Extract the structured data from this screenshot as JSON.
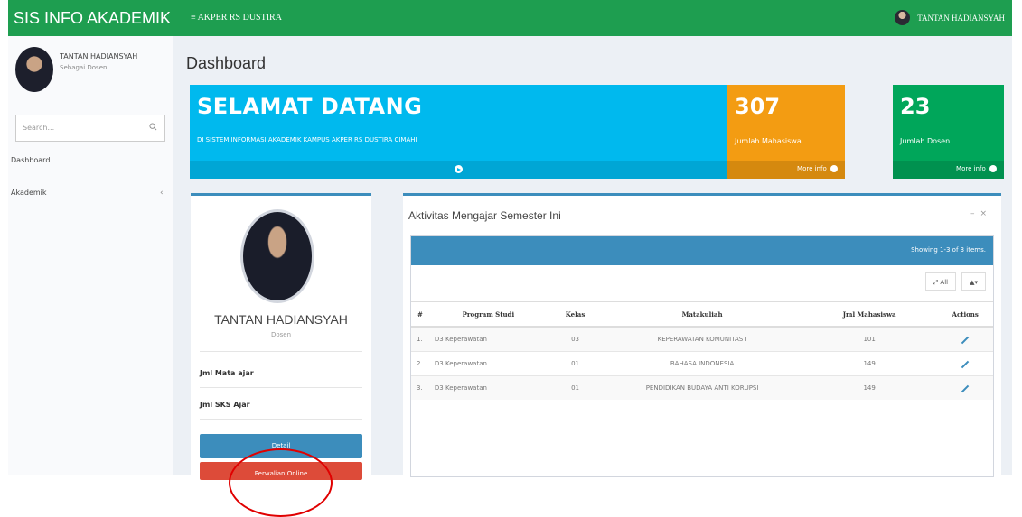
{
  "header": {
    "brand": "SIS INFO AKADEMIK",
    "nav_label": "≡ AKPER RS DUSTIRA",
    "user_name": "TANTAN HADIANSYAH"
  },
  "sidebar": {
    "user_name": "TANTAN HADIANSYAH",
    "user_role": "Sebagai Dosen",
    "search_placeholder": "Search...",
    "items": [
      {
        "label": "Dashboard"
      },
      {
        "label": "Akademik"
      }
    ]
  },
  "page": {
    "title": "Dashboard"
  },
  "welcome": {
    "heading": "SELAMAT DATANG",
    "subtitle": "DI SISTEM INFORMASI AKADEMIK KAMPUS AKPER RS DUSTIRA CIMAHI"
  },
  "stats": [
    {
      "value": "307",
      "label": "Jumlah Mahasiswa",
      "link": "More info",
      "color": "#f39c12"
    },
    {
      "value": "23",
      "label": "Jumlah Dosen",
      "link": "More info",
      "color": "#00a65a"
    }
  ],
  "profile": {
    "name": "TANTAN HADIANSYAH",
    "role": "Dosen",
    "row1": "Jml Mata ajar",
    "row2": "Jml SKS Ajar",
    "btn_detail": "Detail",
    "btn_online": "Perwalian Online"
  },
  "activity": {
    "title": "Aktivitas Mengajar Semester Ini",
    "summary": "Showing 1-3 of 3 items.",
    "btn_all": "All",
    "columns": [
      "#",
      "Program Studi",
      "Kelas",
      "Matakuliah",
      "Jml Mahasiswa",
      "Actions"
    ],
    "rows": [
      {
        "no": "1.",
        "prodi": "D3 Keperawatan",
        "kelas": "03",
        "matkul": "KEPERAWATAN KOMUNITAS I",
        "jml": "101"
      },
      {
        "no": "2.",
        "prodi": "D3 Keperawatan",
        "kelas": "01",
        "matkul": "BAHASA INDONESIA",
        "jml": "149"
      },
      {
        "no": "3.",
        "prodi": "D3 Keperawatan",
        "kelas": "01",
        "matkul": "PENDIDIKAN BUDAYA ANTI KORUPSI",
        "jml": "149"
      }
    ]
  },
  "colors": {
    "topbar": "#1e9e50",
    "welcome": "#00b9ee",
    "primary": "#3c8dbc",
    "danger": "#dd4b39",
    "annotation": "#e00000"
  },
  "icons": [
    "user-avatar-icon",
    "search-icon",
    "chevron-left-icon",
    "arrow-circle-right-icon",
    "expand-icon",
    "user-dropdown-icon",
    "pencil-icon"
  ]
}
